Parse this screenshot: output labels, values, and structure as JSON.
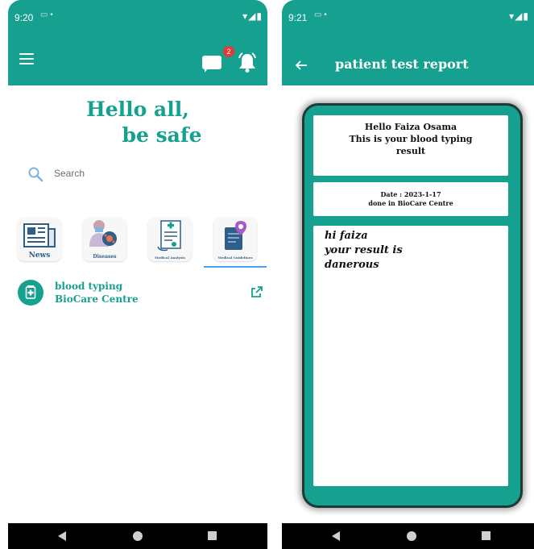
{
  "left": {
    "status": {
      "time": "9:20"
    },
    "greeting": {
      "line1": "Hello all,",
      "line2": "be safe"
    },
    "notifications": {
      "badge": "2"
    },
    "search": {
      "placeholder": "Search"
    },
    "categories": [
      {
        "label": "News"
      },
      {
        "label": "Diseases"
      },
      {
        "label": "Medical Analysis"
      },
      {
        "label": "Medical Guidelines"
      }
    ],
    "list_item": {
      "line1": "blood typing",
      "line2": "BioCare Centre"
    }
  },
  "right": {
    "status": {
      "time": "9:21"
    },
    "title": "patient test report",
    "report": {
      "hello_line": "Hello Faiza Osama",
      "result_line1": "This is your blood typing",
      "result_line2": "result",
      "date_line": "Date : 2023-1-17",
      "centre_line": "done in BioCare Centre",
      "message_line1": "hi faiza",
      "message_line2": "your result is",
      "message_line3": "danerous"
    }
  },
  "colors": {
    "primary": "#16a08f",
    "accent_blue": "#4aa3f0",
    "badge_red": "#e53935"
  }
}
